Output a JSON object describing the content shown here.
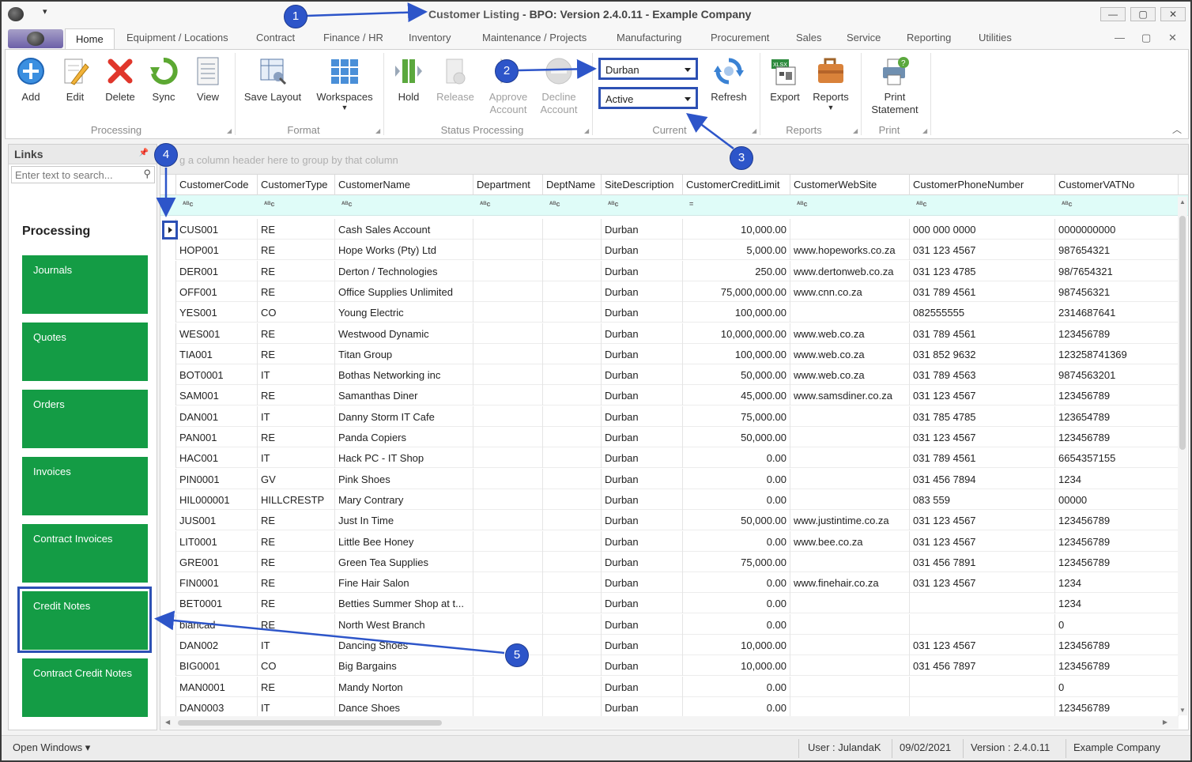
{
  "window": {
    "title_prefix": "Customer Listing",
    "title_rest": " - BPO: Version 2.4.0.11 - Example Company",
    "qa_menu": "▾",
    "controls": [
      "—",
      "▢",
      "✕"
    ]
  },
  "tabs": [
    "Home",
    "Equipment / Locations",
    "Contract",
    "Finance / HR",
    "Inventory",
    "Maintenance / Projects",
    "Manufacturing",
    "Procurement",
    "Sales",
    "Service",
    "Reporting",
    "Utilities"
  ],
  "mdi_controls": [
    "—",
    "▢",
    "✕"
  ],
  "ribbon": {
    "add": "Add",
    "edit": "Edit",
    "delete": "Delete",
    "sync": "Sync",
    "view": "View",
    "save_layout": "Save Layout",
    "workspaces": "Workspaces",
    "hold": "Hold",
    "release": "Release",
    "approve_1": "Approve",
    "approve_2": "Account",
    "decline_1": "Decline",
    "decline_2": "Account",
    "site_combo": "Durban",
    "status_combo": "Active",
    "refresh": "Refresh",
    "export": "Export",
    "reports": "Reports",
    "print_1": "Print",
    "print_2": "Statement",
    "groups": {
      "processing": "Processing",
      "format": "Format",
      "status_processing": "Status Processing",
      "current": "Current",
      "reports": "Reports",
      "print": "Print"
    }
  },
  "links": {
    "title": "Links",
    "search_placeholder": "Enter text to search...",
    "section": "Processing",
    "tiles": [
      "Journals",
      "Quotes",
      "Orders",
      "Invoices",
      "Contract Invoices",
      "Credit Notes",
      "Contract Credit Notes"
    ]
  },
  "grid": {
    "group_hint": "g a column header here to group by that column",
    "columns": [
      "CustomerCode",
      "CustomerType",
      "CustomerName",
      "Department",
      "DeptName",
      "SiteDescription",
      "CustomerCreditLimit",
      "CustomerWebSite",
      "CustomerPhoneNumber",
      "CustomerVATNo"
    ],
    "rows": [
      [
        "CUS001",
        "RE",
        "Cash Sales Account",
        "",
        "",
        "Durban",
        "10,000.00",
        "",
        "000 000 0000",
        "0000000000"
      ],
      [
        "HOP001",
        "RE",
        "Hope Works (Pty) Ltd",
        "",
        "",
        "Durban",
        "5,000.00",
        "www.hopeworks.co.za",
        "031 123 4567",
        "987654321"
      ],
      [
        "DER001",
        "RE",
        "Derton / Technologies",
        "",
        "",
        "Durban",
        "250.00",
        "www.dertonweb.co.za",
        "031 123 4785",
        "98/7654321"
      ],
      [
        "OFF001",
        "RE",
        "Office Supplies Unlimited",
        "",
        "",
        "Durban",
        "75,000,000.00",
        "www.cnn.co.za",
        "031 789 4561",
        "987456321"
      ],
      [
        "YES001",
        "CO",
        "Young Electric",
        "",
        "",
        "Durban",
        "100,000.00",
        "",
        "082555555",
        "2314687641"
      ],
      [
        "WES001",
        "RE",
        "Westwood Dynamic",
        "",
        "",
        "Durban",
        "10,000,000.00",
        "www.web.co.za",
        "031 789 4561",
        "123456789"
      ],
      [
        "TIA001",
        "RE",
        "Titan Group",
        "",
        "",
        "Durban",
        "100,000.00",
        "www.web.co.za",
        "031 852 9632",
        "123258741369"
      ],
      [
        "BOT0001",
        "IT",
        "Bothas Networking inc",
        "",
        "",
        "Durban",
        "50,000.00",
        "www.web.co.za",
        "031 789 4563",
        "9874563201"
      ],
      [
        "SAM001",
        "RE",
        "Samanthas Diner",
        "",
        "",
        "Durban",
        "45,000.00",
        "www.samsdiner.co.za",
        "031 123 4567",
        "123456789"
      ],
      [
        "DAN001",
        "IT",
        "Danny Storm IT Cafe",
        "",
        "",
        "Durban",
        "75,000.00",
        "",
        "031 785 4785",
        "123654789"
      ],
      [
        "PAN001",
        "RE",
        "Panda Copiers",
        "",
        "",
        "Durban",
        "50,000.00",
        "",
        "031 123 4567",
        "123456789"
      ],
      [
        "HAC001",
        "IT",
        "Hack PC - IT Shop",
        "",
        "",
        "Durban",
        "0.00",
        "",
        "031 789 4561",
        "6654357155"
      ],
      [
        "PIN0001",
        "GV",
        "Pink Shoes",
        "",
        "",
        "Durban",
        "0.00",
        "",
        "031 456 7894",
        "1234"
      ],
      [
        "HIL000001",
        "HILLCRESTP",
        "Mary Contrary",
        "",
        "",
        "Durban",
        "0.00",
        "",
        "083 559",
        "00000"
      ],
      [
        "JUS001",
        "RE",
        "Just In Time",
        "",
        "",
        "Durban",
        "50,000.00",
        "www.justintime.co.za",
        "031 123 4567",
        "123456789"
      ],
      [
        "LIT0001",
        "RE",
        "Little Bee Honey",
        "",
        "",
        "Durban",
        "0.00",
        "www.bee.co.za",
        "031 123 4567",
        "123456789"
      ],
      [
        "GRE001",
        "RE",
        "Green Tea Supplies",
        "",
        "",
        "Durban",
        "75,000.00",
        "",
        "031 456 7891",
        "123456789"
      ],
      [
        "FIN0001",
        "RE",
        "Fine Hair Salon",
        "",
        "",
        "Durban",
        "0.00",
        "www.finehair.co.za",
        "031 123 4567",
        "1234"
      ],
      [
        "BET0001",
        "RE",
        "Betties Summer Shop at t...",
        "",
        "",
        "Durban",
        "0.00",
        "",
        "",
        "1234"
      ],
      [
        "biancad",
        "RE",
        "North West Branch",
        "",
        "",
        "Durban",
        "0.00",
        "",
        "",
        "0"
      ],
      [
        "DAN002",
        "IT",
        "Dancing Shoes",
        "",
        "",
        "Durban",
        "10,000.00",
        "",
        "031 123 4567",
        "123456789"
      ],
      [
        "BIG0001",
        "CO",
        "Big Bargains",
        "",
        "",
        "Durban",
        "10,000.00",
        "",
        "031 456 7897",
        "123456789"
      ],
      [
        "MAN0001",
        "RE",
        "Mandy Norton",
        "",
        "",
        "Durban",
        "0.00",
        "",
        "",
        "0"
      ],
      [
        "DAN0003",
        "IT",
        "Dance Shoes",
        "",
        "",
        "Durban",
        "0.00",
        "",
        "",
        "123456789"
      ]
    ]
  },
  "statusbar": {
    "open_windows": "Open Windows ▾",
    "user": "User : JulandaK",
    "date": "09/02/2021",
    "version": "Version : 2.4.0.11",
    "company": "Example Company"
  },
  "callouts": [
    "1",
    "2",
    "3",
    "4",
    "5"
  ],
  "colors": {
    "accent": "#2d55c9",
    "tile": "#149c45",
    "filter_row": "#dffcf8"
  }
}
